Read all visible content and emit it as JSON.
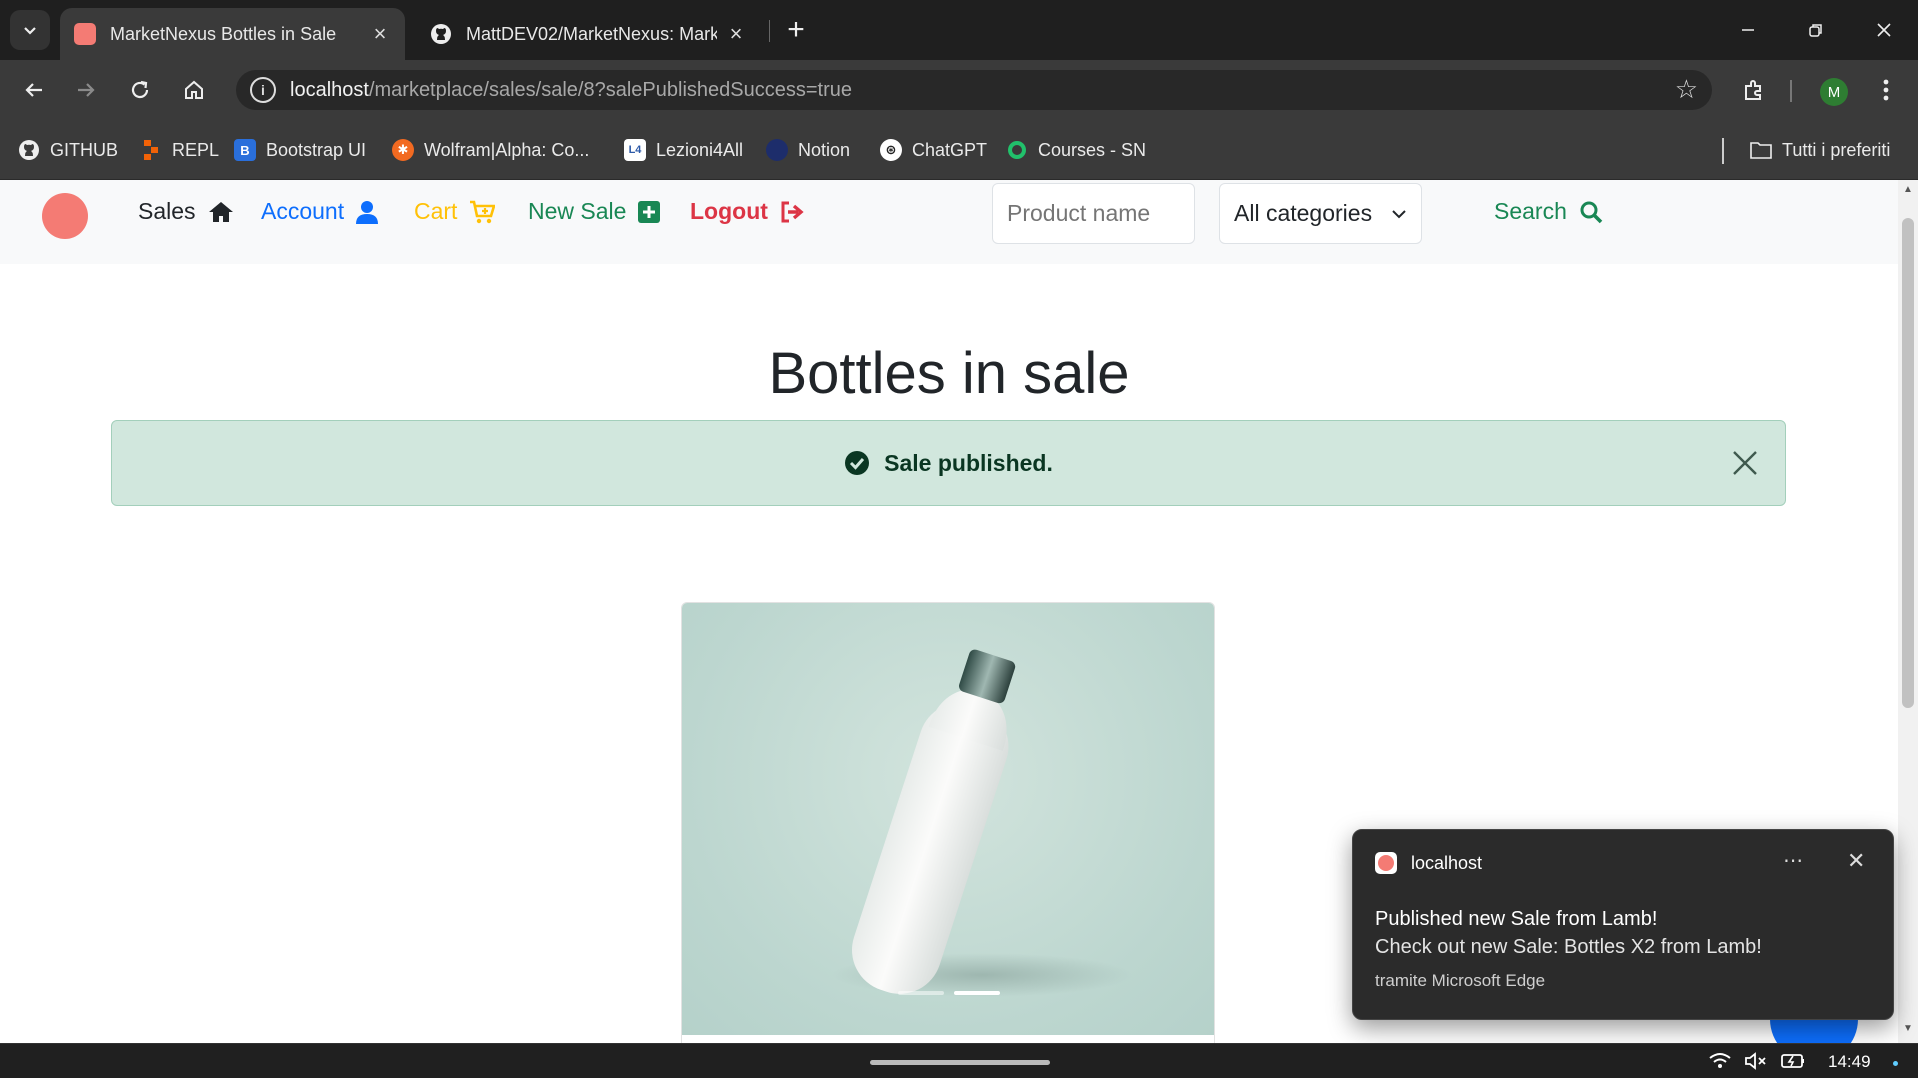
{
  "browser": {
    "tabs": [
      {
        "title": "MarketNexus Bottles in Sale",
        "active": true
      },
      {
        "title": "MattDEV02/MarketNexus: Mark",
        "active": false
      }
    ],
    "url_host": "localhost",
    "url_path": "/marketplace/sales/sale/8?salePublishedSuccess=true",
    "profile_initial": "M",
    "bookmarks": [
      {
        "label": "GITHUB",
        "icon": "github-icon"
      },
      {
        "label": "REPL",
        "icon": "replit-icon"
      },
      {
        "label": "Bootstrap UI",
        "icon": "bootstrap-icon"
      },
      {
        "label": "Wolfram|Alpha: Co...",
        "icon": "wolfram-icon"
      },
      {
        "label": "Lezioni4All",
        "icon": "lezioni-icon"
      },
      {
        "label": "Notion",
        "icon": "notion-icon"
      },
      {
        "label": "ChatGPT",
        "icon": "chatgpt-icon"
      },
      {
        "label": "Courses - SN",
        "icon": "courses-icon"
      }
    ],
    "all_bookmarks_label": "Tutti i preferiti"
  },
  "navbar": {
    "sales_label": "Sales",
    "account_label": "Account",
    "cart_label": "Cart",
    "new_sale_label": "New Sale",
    "logout_label": "Logout",
    "search_placeholder": "Product name",
    "category_selected": "All categories",
    "search_label": "Search",
    "colors": {
      "account": "#0d6efd",
      "cart": "#ffc107",
      "new_sale": "#198754",
      "logout": "#dc3545",
      "search": "#198754"
    }
  },
  "main": {
    "title": "Bottles in sale",
    "alert_text": "Sale published.",
    "alert_color": "#d1e7dd",
    "carousel_slides": 2,
    "carousel_active": 2
  },
  "notification": {
    "source": "localhost",
    "title": "Published new Sale from Lamb!",
    "body": "Check out new Sale: Bottles X2 from Lamb!",
    "via": "tramite Microsoft Edge"
  },
  "taskbar": {
    "time": "14:49"
  }
}
